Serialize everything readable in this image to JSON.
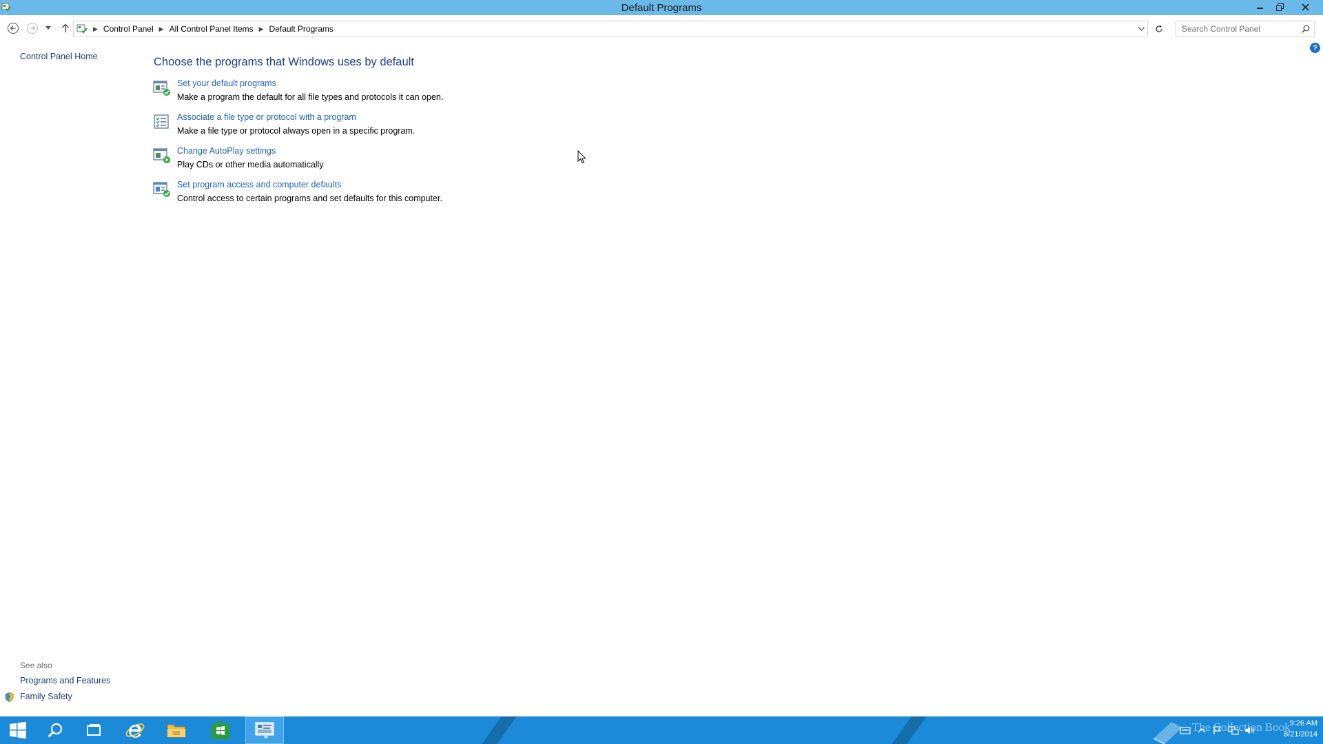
{
  "window": {
    "title": "Default Programs"
  },
  "address": {
    "breadcrumbs": [
      "Control Panel",
      "All Control Panel Items",
      "Default Programs"
    ]
  },
  "search": {
    "placeholder": "Search Control Panel"
  },
  "left_pane": {
    "home_link": "Control Panel Home",
    "see_also_label": "See also",
    "see_also_links": [
      "Programs and Features",
      "Family Safety"
    ]
  },
  "main": {
    "heading": "Choose the programs that Windows uses by default",
    "tasks": [
      {
        "link": "Set your default programs",
        "description": "Make a program the default for all file types and protocols it can open.",
        "icon": "default-programs-icon"
      },
      {
        "link": "Associate a file type or protocol with a program",
        "description": "Make a file type or protocol always open in a specific program.",
        "icon": "file-association-icon"
      },
      {
        "link": "Change AutoPlay settings",
        "description": "Play CDs or other media automatically",
        "icon": "autoplay-icon"
      },
      {
        "link": "Set program access and computer defaults",
        "description": "Control access to certain programs and set defaults for this computer.",
        "icon": "program-access-icon"
      }
    ]
  },
  "taskbar": {
    "watermark": "The Collection Book",
    "time": "9:26 AM",
    "date": "8/21/2014",
    "items": [
      "start-icon",
      "search-icon",
      "task-view-icon",
      "internet-explorer-icon",
      "file-explorer-icon",
      "store-icon",
      "control-panel-icon"
    ],
    "active_item": "control-panel-icon"
  },
  "colors": {
    "titlebar": "#6ab9e8",
    "taskbar": "#1a8ad9",
    "link": "#1f62b8",
    "heading": "#1e3f8a"
  }
}
